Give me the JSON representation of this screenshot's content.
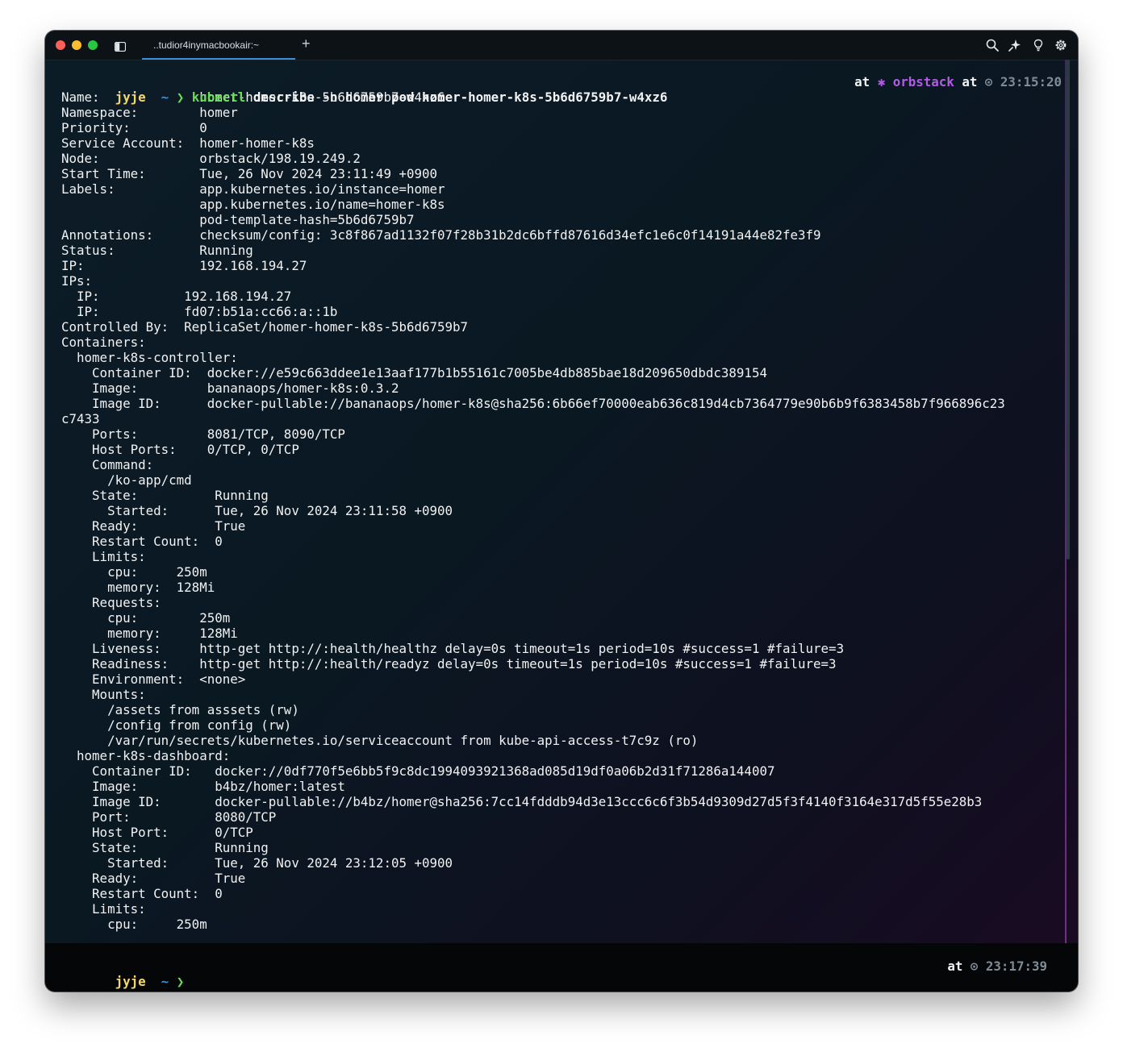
{
  "window": {
    "tab_title": "..tudior4inymacbookair:~",
    "new_tab_label": "+"
  },
  "prompt": {
    "apple": "",
    "user": "jyje",
    "home_icon": "",
    "cwd": "~",
    "arrow": "❯",
    "cmd_name": "kubectl",
    "cmd_args": " describe -n homer pod homer-homer-k8s-5b6d6759b7-w4xz6",
    "at1": "at",
    "context_icon": "✱",
    "context": "orbstack",
    "at2": "at",
    "clock_icon": "⊙",
    "time": "23:15:20"
  },
  "output_lines": [
    "Name:             homer-homer-k8s-5b6d6759b7-w4xz6",
    "Namespace:        homer",
    "Priority:         0",
    "Service Account:  homer-homer-k8s",
    "Node:             orbstack/198.19.249.2",
    "Start Time:       Tue, 26 Nov 2024 23:11:49 +0900",
    "Labels:           app.kubernetes.io/instance=homer",
    "                  app.kubernetes.io/name=homer-k8s",
    "                  pod-template-hash=5b6d6759b7",
    "Annotations:      checksum/config: 3c8f867ad1132f07f28b31b2dc6bffd87616d34efc1e6c0f14191a44e82fe3f9",
    "Status:           Running",
    "IP:               192.168.194.27",
    "IPs:",
    "  IP:           192.168.194.27",
    "  IP:           fd07:b51a:cc66:a::1b",
    "Controlled By:  ReplicaSet/homer-homer-k8s-5b6d6759b7",
    "Containers:",
    "  homer-k8s-controller:",
    "    Container ID:  docker://e59c663ddee1e13aaf177b1b55161c7005be4db885bae18d209650dbdc389154",
    "    Image:         bananaops/homer-k8s:0.3.2",
    "    Image ID:      docker-pullable://bananaops/homer-k8s@sha256:6b66ef70000eab636c819d4cb7364779e90b6b9f6383458b7f966896c23",
    "c7433",
    "    Ports:         8081/TCP, 8090/TCP",
    "    Host Ports:    0/TCP, 0/TCP",
    "    Command:",
    "      /ko-app/cmd",
    "    State:          Running",
    "      Started:      Tue, 26 Nov 2024 23:11:58 +0900",
    "    Ready:          True",
    "    Restart Count:  0",
    "    Limits:",
    "      cpu:     250m",
    "      memory:  128Mi",
    "    Requests:",
    "      cpu:        250m",
    "      memory:     128Mi",
    "    Liveness:     http-get http://:health/healthz delay=0s timeout=1s period=10s #success=1 #failure=3",
    "    Readiness:    http-get http://:health/readyz delay=0s timeout=1s period=10s #success=1 #failure=3",
    "    Environment:  <none>",
    "    Mounts:",
    "      /assets from asssets (rw)",
    "      /config from config (rw)",
    "      /var/run/secrets/kubernetes.io/serviceaccount from kube-api-access-t7c9z (ro)",
    "  homer-k8s-dashboard:",
    "    Container ID:   docker://0df770f5e6bb5f9c8dc1994093921368ad085d19df0a06b2d31f71286a144007",
    "    Image:          b4bz/homer:latest",
    "    Image ID:       docker-pullable://b4bz/homer@sha256:7cc14fdddb94d3e13ccc6c6f3b54d9309d27d5f3f4140f3164e317d5f55e28b3",
    "    Port:           8080/TCP",
    "    Host Port:      0/TCP",
    "    State:          Running",
    "      Started:      Tue, 26 Nov 2024 23:12:05 +0900",
    "    Ready:          True",
    "    Restart Count:  0",
    "    Limits:",
    "      cpu:     250m"
  ],
  "bottom_prompt": {
    "apple": "",
    "user": "jyje",
    "home_icon": "",
    "cwd": "~",
    "arrow": "❯",
    "at": "at",
    "clock_icon": "⊙",
    "time": "23:17:39"
  },
  "colors": {
    "background": "#0a1822",
    "user": "#f5d76e",
    "command": "#6adf52",
    "context": "#b25ce6",
    "timestamp": "#7f8c97",
    "tab_accent": "#3b8fd9"
  }
}
